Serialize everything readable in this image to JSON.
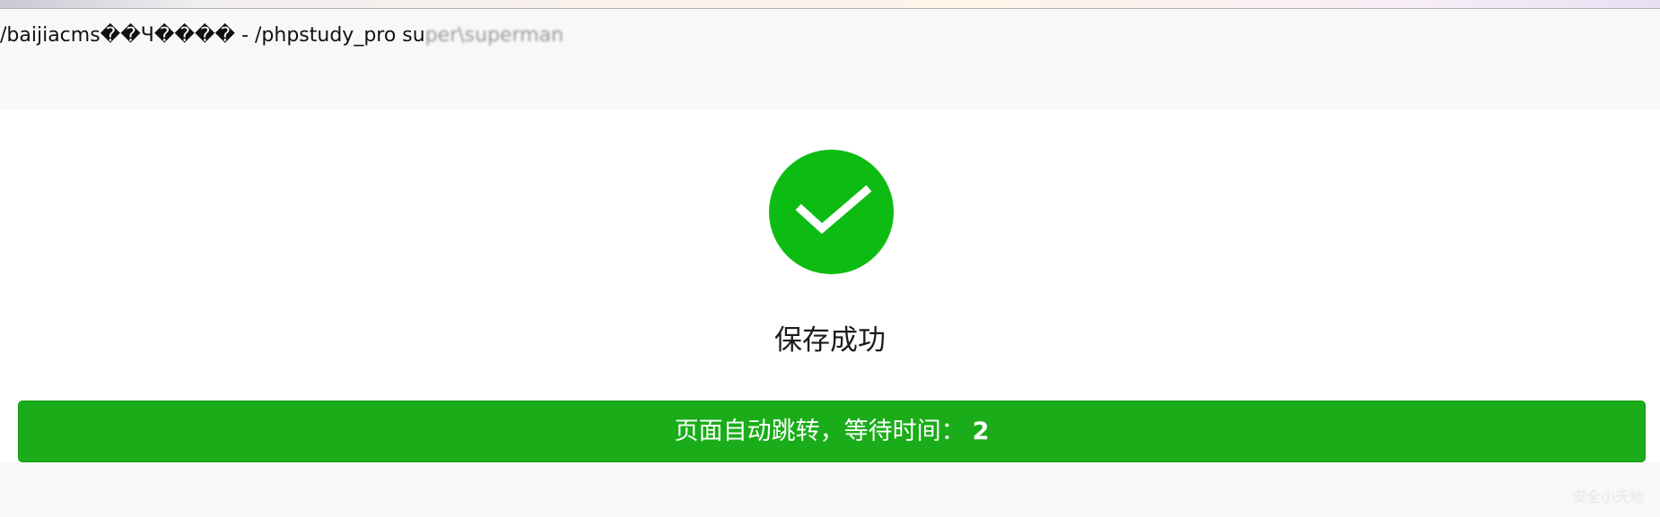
{
  "header": {
    "path_prefix": "/baijiacms��Ч���� - /phpstudy_pro su",
    "path_blurred": "per\\superman"
  },
  "icons": {
    "success": "check-circle-icon",
    "success_color": "#0cbc12"
  },
  "message": {
    "title": "保存成功",
    "redirect_label": "页面自动跳转，等待时间：",
    "redirect_seconds": "2",
    "bar_color": "#1aad19"
  },
  "watermark": "安全小天地"
}
